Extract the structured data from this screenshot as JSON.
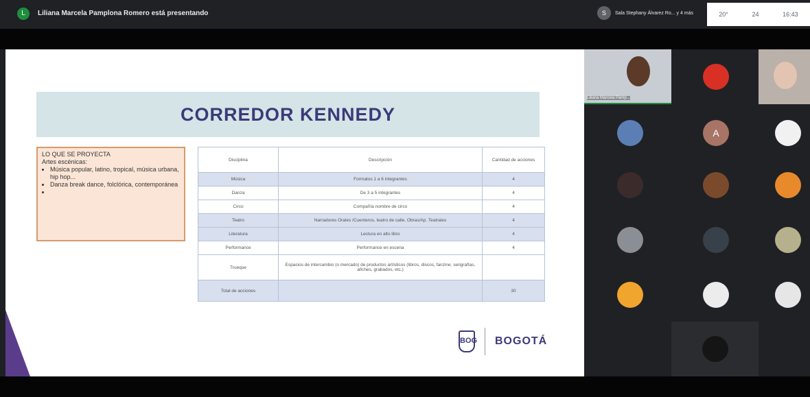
{
  "topbar": {
    "presenter_initial": "L",
    "presenter_text": "Liliana Marcela Pamplona Romero está presentando",
    "pinned_initial": "S",
    "pinned_text": "Sala Stephany Álvarez Ro... y 4 más",
    "status": [
      "20°",
      "24",
      "16:43"
    ]
  },
  "slide": {
    "title": "CORREDOR KENNEDY",
    "box_heading": "LO QUE SE PROYECTA",
    "box_subheading": "Artes escénicas:",
    "box_items": [
      "Música popular, latino, tropical, música urbana, hip hop...",
      "Danza break dance, folclórica, contemporánea",
      ""
    ],
    "table": {
      "headers": [
        "Disciplina",
        "Descripción",
        "Cantidad de acciones"
      ],
      "rows": [
        {
          "discipline": "Música",
          "description": "Formatos 1 a 6 integrantes",
          "qty": "4"
        },
        {
          "discipline": "Danza",
          "description": "De 3 a 5 integrantes",
          "qty": "4"
        },
        {
          "discipline": "Circo",
          "description": "Compañía nombre de circo",
          "qty": "4"
        },
        {
          "discipline": "Teatro",
          "description": "Narradores Orales /Cuenteros, teatro de calle, Obras/Ap. Teatrales",
          "qty": "4"
        },
        {
          "discipline": "Literatura",
          "description": "Lectura en alto libro",
          "qty": "4"
        },
        {
          "discipline": "Performance",
          "description": "Performance en escena",
          "qty": "4"
        }
      ],
      "tall_row": {
        "discipline": "Trueque",
        "description": "Espacios de intercambio (o mercado) de productos artísticos (libros, discos, fanzine, serigrafías, afiches, grabados, etc.)",
        "qty": ""
      },
      "total": {
        "label": "Total de acciones",
        "description": "",
        "qty": "30"
      }
    },
    "logo_text": "BOGOTÁ",
    "shield_label": "BOG"
  },
  "participants": {
    "video1_caption": "Liliana Marcela Pamp...",
    "letters": [
      "A"
    ]
  }
}
